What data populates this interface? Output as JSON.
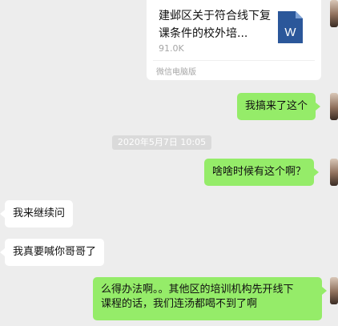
{
  "file_message": {
    "title": "建邺区关于符合线下复课条件的校外培...",
    "size": "91.0K",
    "source": "微信电脑版",
    "icon": "word-doc-icon",
    "icon_letter": "W",
    "icon_color": "#2b579a"
  },
  "messages": [
    {
      "text": "我搞来了这个"
    },
    {
      "text": "啥啥时候有这个啊？"
    },
    {
      "text": "我来继续问"
    },
    {
      "text": "我真要喊你哥哥了"
    },
    {
      "line1": "么得办法啊。。其他区的培训机构先开线下",
      "line2": "课程的话，我们连汤都喝不到了啊"
    }
  ],
  "timestamp": "2020年5月7日 10:05",
  "colors": {
    "background": "#ededed",
    "my_bubble": "#95ec69",
    "other_bubble": "#ffffff"
  }
}
